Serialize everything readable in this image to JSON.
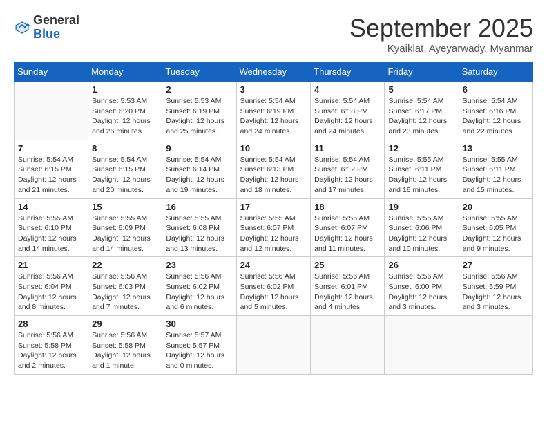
{
  "header": {
    "logo_general": "General",
    "logo_blue": "Blue",
    "month_title": "September 2025",
    "subtitle": "Kyaiklat, Ayeyarwady, Myanmar"
  },
  "days_of_week": [
    "Sunday",
    "Monday",
    "Tuesday",
    "Wednesday",
    "Thursday",
    "Friday",
    "Saturday"
  ],
  "weeks": [
    [
      {
        "day": "",
        "info": ""
      },
      {
        "day": "1",
        "info": "Sunrise: 5:53 AM\nSunset: 6:20 PM\nDaylight: 12 hours\nand 26 minutes."
      },
      {
        "day": "2",
        "info": "Sunrise: 5:53 AM\nSunset: 6:19 PM\nDaylight: 12 hours\nand 25 minutes."
      },
      {
        "day": "3",
        "info": "Sunrise: 5:54 AM\nSunset: 6:19 PM\nDaylight: 12 hours\nand 24 minutes."
      },
      {
        "day": "4",
        "info": "Sunrise: 5:54 AM\nSunset: 6:18 PM\nDaylight: 12 hours\nand 24 minutes."
      },
      {
        "day": "5",
        "info": "Sunrise: 5:54 AM\nSunset: 6:17 PM\nDaylight: 12 hours\nand 23 minutes."
      },
      {
        "day": "6",
        "info": "Sunrise: 5:54 AM\nSunset: 6:16 PM\nDaylight: 12 hours\nand 22 minutes."
      }
    ],
    [
      {
        "day": "7",
        "info": "Sunrise: 5:54 AM\nSunset: 6:15 PM\nDaylight: 12 hours\nand 21 minutes."
      },
      {
        "day": "8",
        "info": "Sunrise: 5:54 AM\nSunset: 6:15 PM\nDaylight: 12 hours\nand 20 minutes."
      },
      {
        "day": "9",
        "info": "Sunrise: 5:54 AM\nSunset: 6:14 PM\nDaylight: 12 hours\nand 19 minutes."
      },
      {
        "day": "10",
        "info": "Sunrise: 5:54 AM\nSunset: 6:13 PM\nDaylight: 12 hours\nand 18 minutes."
      },
      {
        "day": "11",
        "info": "Sunrise: 5:54 AM\nSunset: 6:12 PM\nDaylight: 12 hours\nand 17 minutes."
      },
      {
        "day": "12",
        "info": "Sunrise: 5:55 AM\nSunset: 6:11 PM\nDaylight: 12 hours\nand 16 minutes."
      },
      {
        "day": "13",
        "info": "Sunrise: 5:55 AM\nSunset: 6:11 PM\nDaylight: 12 hours\nand 15 minutes."
      }
    ],
    [
      {
        "day": "14",
        "info": "Sunrise: 5:55 AM\nSunset: 6:10 PM\nDaylight: 12 hours\nand 14 minutes."
      },
      {
        "day": "15",
        "info": "Sunrise: 5:55 AM\nSunset: 6:09 PM\nDaylight: 12 hours\nand 14 minutes."
      },
      {
        "day": "16",
        "info": "Sunrise: 5:55 AM\nSunset: 6:08 PM\nDaylight: 12 hours\nand 13 minutes."
      },
      {
        "day": "17",
        "info": "Sunrise: 5:55 AM\nSunset: 6:07 PM\nDaylight: 12 hours\nand 12 minutes."
      },
      {
        "day": "18",
        "info": "Sunrise: 5:55 AM\nSunset: 6:07 PM\nDaylight: 12 hours\nand 11 minutes."
      },
      {
        "day": "19",
        "info": "Sunrise: 5:55 AM\nSunset: 6:06 PM\nDaylight: 12 hours\nand 10 minutes."
      },
      {
        "day": "20",
        "info": "Sunrise: 5:55 AM\nSunset: 6:05 PM\nDaylight: 12 hours\nand 9 minutes."
      }
    ],
    [
      {
        "day": "21",
        "info": "Sunrise: 5:56 AM\nSunset: 6:04 PM\nDaylight: 12 hours\nand 8 minutes."
      },
      {
        "day": "22",
        "info": "Sunrise: 5:56 AM\nSunset: 6:03 PM\nDaylight: 12 hours\nand 7 minutes."
      },
      {
        "day": "23",
        "info": "Sunrise: 5:56 AM\nSunset: 6:02 PM\nDaylight: 12 hours\nand 6 minutes."
      },
      {
        "day": "24",
        "info": "Sunrise: 5:56 AM\nSunset: 6:02 PM\nDaylight: 12 hours\nand 5 minutes."
      },
      {
        "day": "25",
        "info": "Sunrise: 5:56 AM\nSunset: 6:01 PM\nDaylight: 12 hours\nand 4 minutes."
      },
      {
        "day": "26",
        "info": "Sunrise: 5:56 AM\nSunset: 6:00 PM\nDaylight: 12 hours\nand 3 minutes."
      },
      {
        "day": "27",
        "info": "Sunrise: 5:56 AM\nSunset: 5:59 PM\nDaylight: 12 hours\nand 3 minutes."
      }
    ],
    [
      {
        "day": "28",
        "info": "Sunrise: 5:56 AM\nSunset: 5:58 PM\nDaylight: 12 hours\nand 2 minutes."
      },
      {
        "day": "29",
        "info": "Sunrise: 5:56 AM\nSunset: 5:58 PM\nDaylight: 12 hours\nand 1 minute."
      },
      {
        "day": "30",
        "info": "Sunrise: 5:57 AM\nSunset: 5:57 PM\nDaylight: 12 hours\nand 0 minutes."
      },
      {
        "day": "",
        "info": ""
      },
      {
        "day": "",
        "info": ""
      },
      {
        "day": "",
        "info": ""
      },
      {
        "day": "",
        "info": ""
      }
    ]
  ]
}
